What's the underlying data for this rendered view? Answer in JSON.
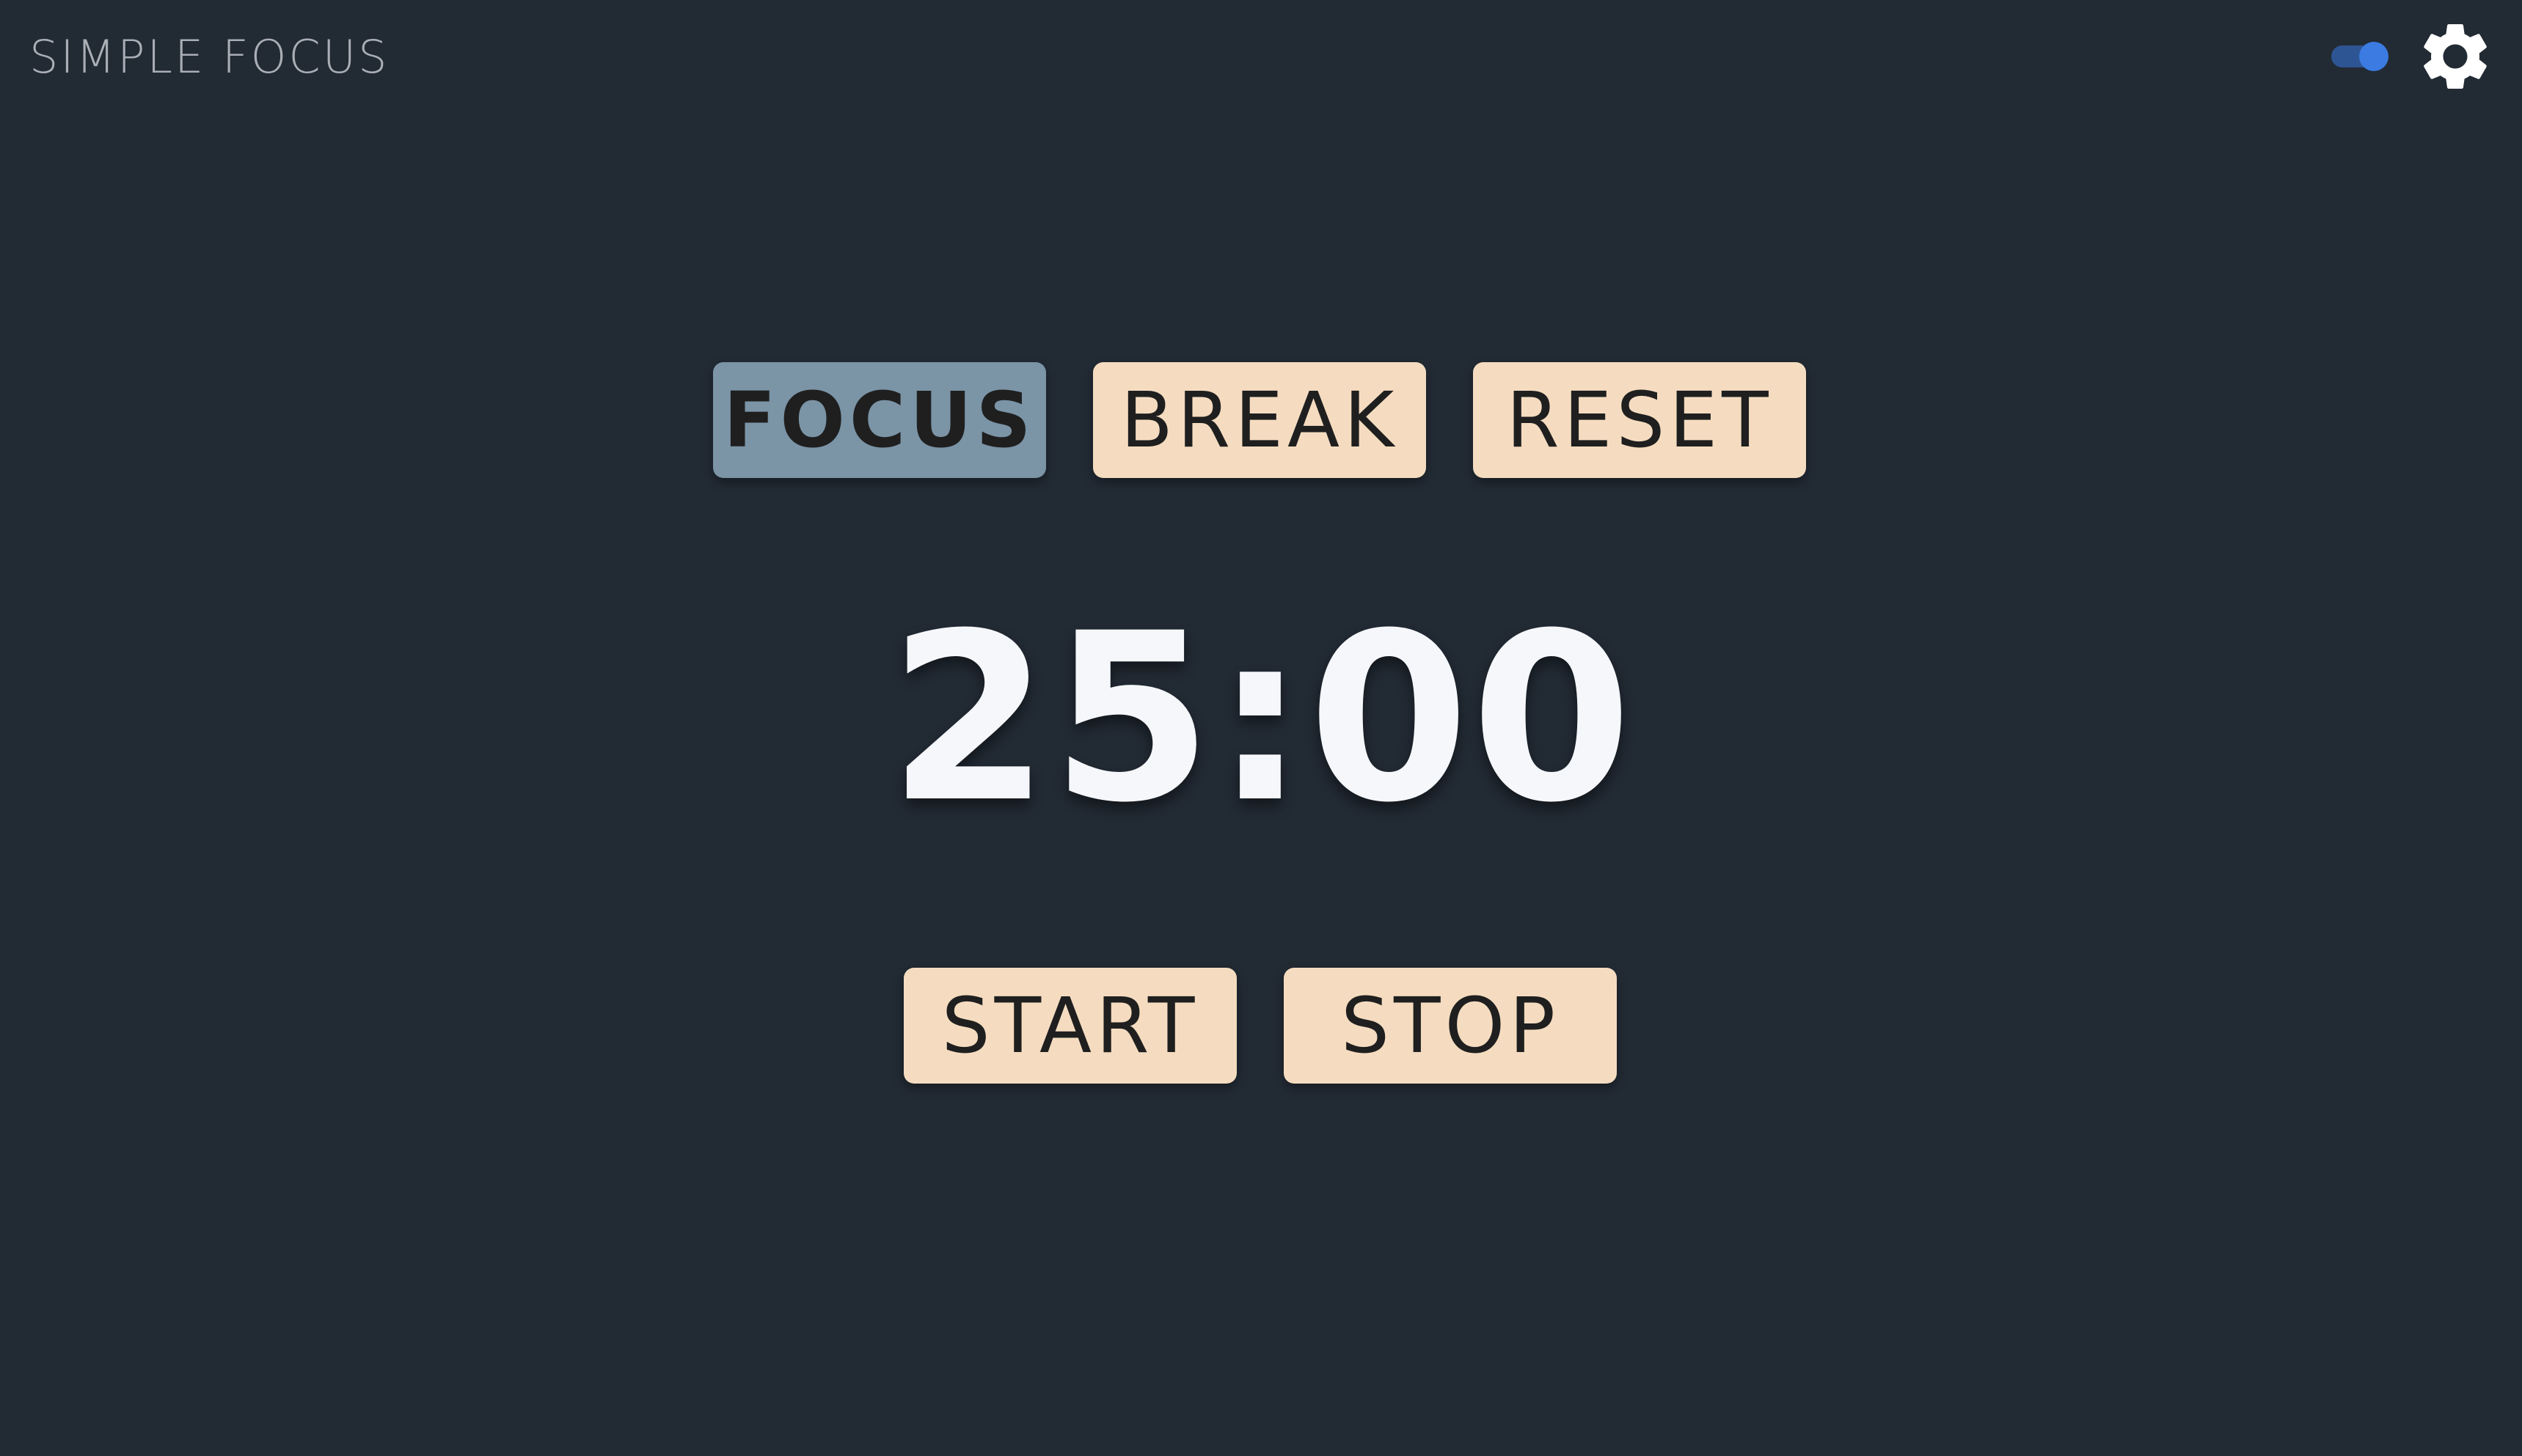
{
  "header": {
    "title": "SIMPLE FOCUS",
    "toggle_on": true,
    "settings_icon": "gear-icon"
  },
  "modes": [
    {
      "label": "FOCUS",
      "active": true
    },
    {
      "label": "BREAK",
      "active": false
    },
    {
      "label": "RESET",
      "active": false
    }
  ],
  "timer": {
    "display": "25:00"
  },
  "actions": {
    "start_label": "START",
    "stop_label": "STOP"
  },
  "colors": {
    "background": "#222a34",
    "button": "#f5dcc0",
    "button_active": "#7b94a6",
    "toggle_track": "#2e5593",
    "toggle_knob": "#3b7be2",
    "timer_text": "#f5f7fb"
  }
}
